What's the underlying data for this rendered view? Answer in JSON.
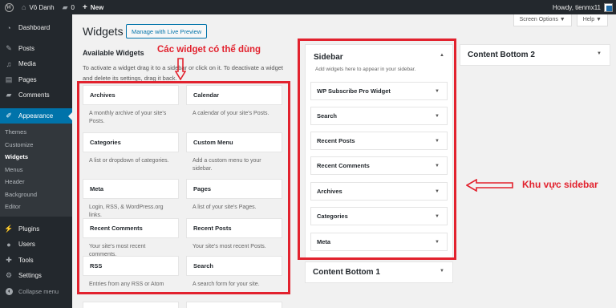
{
  "adminbar": {
    "site_name": "Vô Danh",
    "comments_count": "0",
    "new_label": "New",
    "howdy": "Howdy, tienmx11"
  },
  "menu": {
    "items_top": [
      "Dashboard",
      "Posts",
      "Media",
      "Pages",
      "Comments"
    ],
    "appearance": "Appearance",
    "submenu": [
      "Themes",
      "Customize",
      "Widgets",
      "Menus",
      "Header",
      "Background",
      "Editor"
    ],
    "items_bottom": [
      "Plugins",
      "Users",
      "Tools",
      "Settings"
    ],
    "collapse": "Collapse menu"
  },
  "screen_options": "Screen Options ▼",
  "help": "Help ▼",
  "page": {
    "title": "Widgets",
    "preview_button": "Manage with Live Preview",
    "available_title": "Available Widgets",
    "available_desc": "To activate a widget drag it to a sidebar or click on it. To deactivate a widget and delete its settings, drag it back."
  },
  "widgets": [
    {
      "title": "Archives",
      "desc": "A monthly archive of your site's Posts."
    },
    {
      "title": "Calendar",
      "desc": "A calendar of your site's Posts."
    },
    {
      "title": "Categories",
      "desc": "A list or dropdown of categories."
    },
    {
      "title": "Custom Menu",
      "desc": "Add a custom menu to your sidebar."
    },
    {
      "title": "Meta",
      "desc": "Login, RSS, & WordPress.org links."
    },
    {
      "title": "Pages",
      "desc": "A list of your site's Pages."
    },
    {
      "title": "Recent Comments",
      "desc": "Your site's most recent comments."
    },
    {
      "title": "Recent Posts",
      "desc": "Your site's most recent Posts."
    },
    {
      "title": "RSS",
      "desc": "Entries from any RSS or Atom"
    },
    {
      "title": "Search",
      "desc": "A search form for your site."
    }
  ],
  "annotations": {
    "widgets_label": "Các widget có thể dùng",
    "sidebar_label": "Khu vực sidebar"
  },
  "sidebar": {
    "title": "Sidebar",
    "desc": "Add widgets here to appear in your sidebar.",
    "widgets": [
      "WP Subscribe Pro Widget",
      "Search",
      "Recent Posts",
      "Recent Comments",
      "Archives",
      "Categories",
      "Meta"
    ]
  },
  "content_bottom_1": "Content Bottom 1",
  "content_bottom_2": "Content Bottom 2",
  "colors": {
    "annotation_red": "#e2222e",
    "admin_dark": "#23282d",
    "accent_blue": "#0073aa"
  }
}
